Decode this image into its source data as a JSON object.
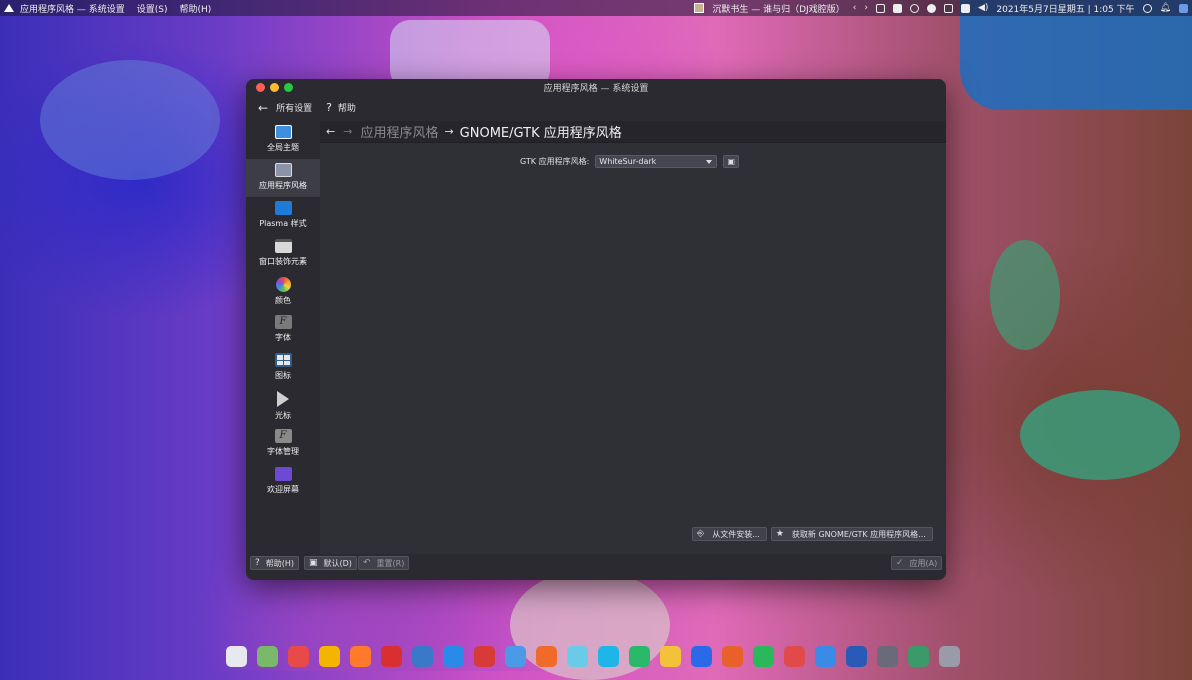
{
  "top_panel": {
    "app_name": "应用程序风格 — 系统设置",
    "menus": [
      "设置(S)",
      "帮助(H)"
    ],
    "now_playing": "沉默书生 — 谁与归（DJ戏腔版）",
    "datetime": "2021年5月7日星期五 | 1:05 下午"
  },
  "window": {
    "title": "应用程序风格 — 系统设置",
    "toolbar": {
      "all_settings": "所有设置",
      "help_icon": "?",
      "help": "帮助"
    },
    "sidebar": {
      "items": [
        {
          "label": "全局主题",
          "icon": "global-theme-icon"
        },
        {
          "label": "应用程序风格",
          "icon": "application-style-icon",
          "active": true
        },
        {
          "label": "Plasma 样式",
          "icon": "plasma-style-icon"
        },
        {
          "label": "窗口装饰元素",
          "icon": "window-decoration-icon"
        },
        {
          "label": "颜色",
          "icon": "colors-icon"
        },
        {
          "label": "字体",
          "icon": "fonts-icon"
        },
        {
          "label": "图标",
          "icon": "icons-icon"
        },
        {
          "label": "光标",
          "icon": "cursor-icon"
        },
        {
          "label": "字体管理",
          "icon": "font-management-icon"
        },
        {
          "label": "欢迎屏幕",
          "icon": "splash-screen-icon"
        }
      ]
    },
    "breadcrumb": {
      "parent": "应用程序风格",
      "current": "GNOME/GTK 应用程序风格"
    },
    "gtk": {
      "label": "GTK 应用程序风格:",
      "selected": "WhiteSur-dark"
    },
    "content_buttons": {
      "install_from_file": "从文件安装...",
      "get_new": "获取新 GNOME/GTK 应用程序风格..."
    },
    "footer": {
      "help": "帮助(H)",
      "defaults": "默认(D)",
      "reset": "重置(R)",
      "apply": "应用(A)"
    }
  },
  "dock": {
    "apps": [
      "launcher-icon",
      "file-manager-icon",
      "app-grid-icon",
      "chrome-icon",
      "firefox-icon",
      "netease-music-icon",
      "steam-icon",
      "vscode-icon",
      "xmind-icon",
      "cloud-icon",
      "pen-icon",
      "pet-icon",
      "star-app-icon",
      "play-store-icon",
      "banana-icon",
      "wps-writer-icon",
      "wps-presentation-icon",
      "wps-spreadsheet-icon",
      "wps-pdf-icon",
      "baidu-netdisk-icon",
      "markdown-icon",
      "obs-icon",
      "terminal-icon",
      "trash-icon"
    ],
    "colors": [
      "#e8e8f0",
      "#7ab86a",
      "#e84a4a",
      "#f4b400",
      "#ff7a2a",
      "#d83030",
      "#3a78c8",
      "#2a8ae8",
      "#d83a3a",
      "#4a9ae8",
      "#f06a2a",
      "#6acbe8",
      "#1eb6e8",
      "#2ab86a",
      "#f4c23a",
      "#2a6ae8",
      "#e8602a",
      "#2ab85a",
      "#e04a4a",
      "#3a8ae8",
      "#2a5ab8",
      "#6a6a7a",
      "#3a9a6a",
      "#9a9aa8"
    ]
  }
}
